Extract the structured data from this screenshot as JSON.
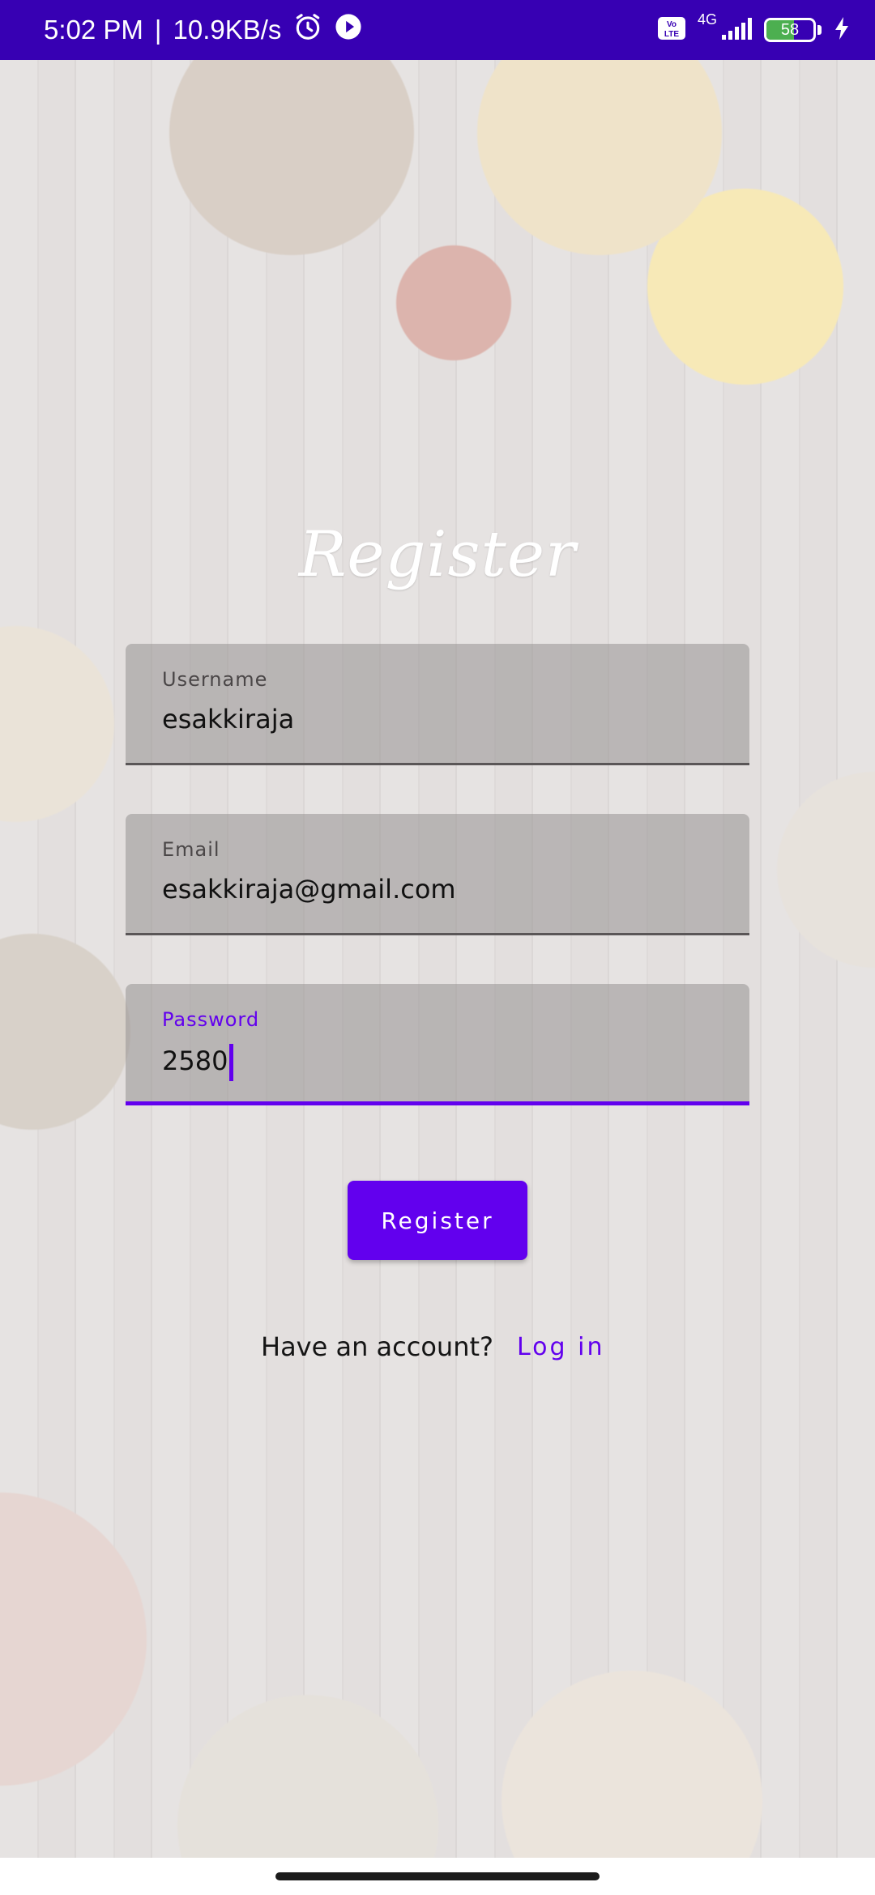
{
  "status_bar": {
    "time": "5:02 PM",
    "speed": "10.9KB/s",
    "network": "4G",
    "volte": "Vo LTE",
    "battery": "58",
    "battery_fraction": 0.58
  },
  "form": {
    "title": "Register",
    "username": {
      "label": "Username",
      "value": "esakkiraja"
    },
    "email": {
      "label": "Email",
      "value": "esakkiraja@gmail.com"
    },
    "password": {
      "label": "Password",
      "value": "2580"
    },
    "submit_label": "Register",
    "account_prompt": "Have an account?",
    "login_label": "Log in"
  },
  "colors": {
    "status_bar": "#3700b3",
    "accent": "#6200ee"
  }
}
